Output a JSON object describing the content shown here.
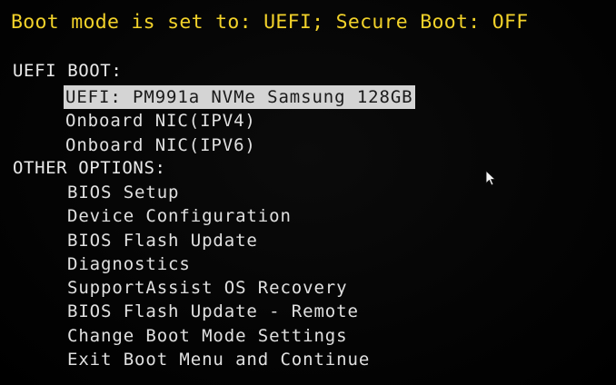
{
  "status": {
    "text": "Boot mode is set to: UEFI; Secure Boot: OFF",
    "color": "#f2d22a"
  },
  "uefi_boot": {
    "header": "UEFI BOOT:",
    "items": [
      {
        "label": "UEFI: PM991a NVMe Samsung 128GB",
        "selected": true
      },
      {
        "label": "Onboard NIC(IPV4)",
        "selected": false
      },
      {
        "label": "Onboard NIC(IPV6)",
        "selected": false
      }
    ]
  },
  "other_options": {
    "header": "OTHER OPTIONS:",
    "items": [
      {
        "label": "BIOS Setup"
      },
      {
        "label": "Device Configuration"
      },
      {
        "label": "BIOS Flash Update"
      },
      {
        "label": "Diagnostics"
      },
      {
        "label": "SupportAssist OS Recovery"
      },
      {
        "label": "BIOS Flash Update - Remote"
      },
      {
        "label": "Change Boot Mode Settings"
      },
      {
        "label": "Exit Boot Menu and Continue"
      }
    ]
  },
  "cursor": {
    "icon": "mouse-pointer-icon"
  }
}
